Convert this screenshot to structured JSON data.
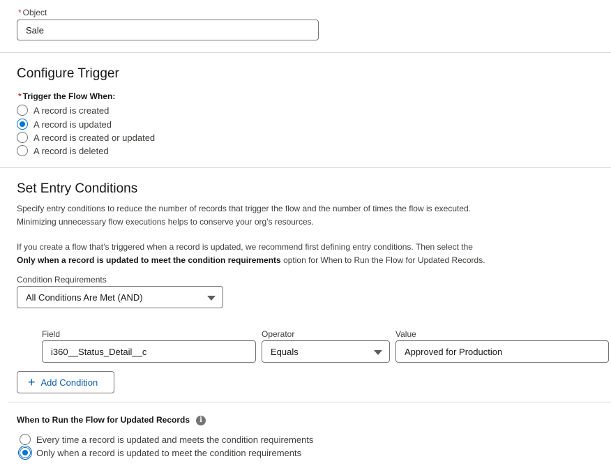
{
  "object": {
    "required_mark": "*",
    "label": "Object",
    "value": "Sale"
  },
  "configure_trigger": {
    "heading": "Configure Trigger",
    "required_mark": "*",
    "label": "Trigger the Flow When:",
    "options": [
      {
        "label": "A record is created",
        "checked": false
      },
      {
        "label": "A record is updated",
        "checked": true
      },
      {
        "label": "A record is created or updated",
        "checked": false
      },
      {
        "label": "A record is deleted",
        "checked": false
      }
    ]
  },
  "entry_conditions": {
    "heading": "Set Entry Conditions",
    "description_line1": "Specify entry conditions to reduce the number of records that trigger the flow and the number of times the flow is executed.",
    "description_line2": "Minimizing unnecessary flow executions helps to conserve your org’s resources.",
    "recommend_line1": "If you create a flow that’s triggered when a record is updated, we recommend first defining entry conditions. Then select the",
    "recommend_bold": "Only when a record is updated to meet the condition requirements",
    "recommend_rest": " option for When to Run the Flow for Updated Records.",
    "condition_requirements_label": "Condition Requirements",
    "condition_requirements_value": "All Conditions Are Met (AND)",
    "field_label": "Field",
    "field_value": "i360__Status_Detail__c",
    "operator_label": "Operator",
    "operator_value": "Equals",
    "value_label": "Value",
    "value_value": "Approved for Production",
    "add_condition_label": "Add Condition"
  },
  "when_to_run": {
    "label": "When to Run the Flow for Updated Records",
    "info_icon": "info-icon",
    "options": [
      {
        "label": "Every time a record is updated and meets the condition requirements",
        "checked": false
      },
      {
        "label": "Only when a record is updated to meet the condition requirements",
        "checked": true
      }
    ]
  },
  "colors": {
    "brand": "#0176d3",
    "link": "#0b5cab",
    "required": "#c23934",
    "border": "#747474"
  }
}
